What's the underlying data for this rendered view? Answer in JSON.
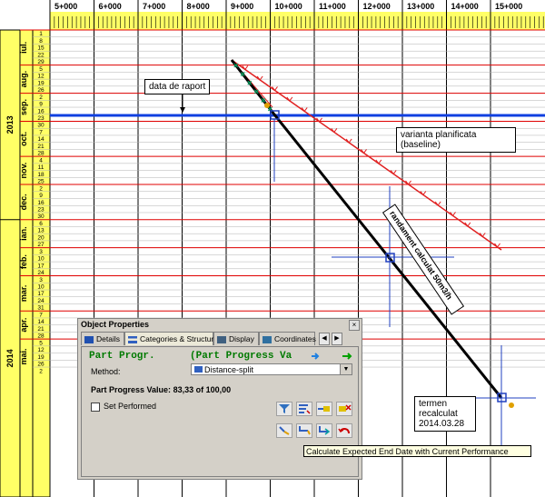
{
  "chart": {
    "km_labels": [
      "5+000",
      "6+000",
      "7+000",
      "8+000",
      "9+000",
      "10+000",
      "11+000",
      "12+000",
      "13+000",
      "14+000",
      "15+000"
    ],
    "years": [
      "2013",
      "2014"
    ],
    "months": [
      "iul.",
      "aug.",
      "sep.",
      "oct.",
      "nov.",
      "dec.",
      "ian.",
      "feb.",
      "mar.",
      "apr.",
      "mai."
    ],
    "week_days": [
      "1",
      "8",
      "15",
      "22",
      "29",
      "5",
      "12",
      "19",
      "26",
      "2",
      "9",
      "16",
      "23",
      "30",
      "7",
      "14",
      "21",
      "28",
      "4",
      "11",
      "18",
      "25",
      "2",
      "9",
      "16",
      "23",
      "30",
      "6",
      "13",
      "20",
      "27",
      "3",
      "10",
      "17",
      "24",
      "3",
      "10",
      "17",
      "24",
      "31",
      "7",
      "14",
      "21",
      "28",
      "5",
      "12",
      "19",
      "26",
      "2"
    ],
    "colors": {
      "grid_red": "#e00000",
      "grid_gray": "#b0b0b0",
      "axis_yellow": "#ffff66",
      "report_line_blue": "#1040e0",
      "baseline_red": "#e02020",
      "actual_black": "#000000",
      "panel_green": "#007a00"
    }
  },
  "annotations": {
    "report_date": "data de raport",
    "baseline": "varianta planificata\n(baseline)",
    "pace": "randament calculat 50m3/h",
    "recalc": "termen\nrecalculat\n2014.03.28"
  },
  "panel": {
    "title": "Object Properties",
    "close": "×",
    "tabs": [
      "Details",
      "Categories & Structure",
      "Display",
      "Coordinates"
    ],
    "header_left": "Part Progr.",
    "header_right": "(Part Progress Va",
    "method_label": "Method:",
    "method_value": "Distance-split",
    "progress_label": "Part Progress Value:",
    "progress_value": "83,33 of 100,00",
    "set_performed": "Set Performed"
  },
  "tooltip": "Calculate Expected End Date with Current Performance"
}
